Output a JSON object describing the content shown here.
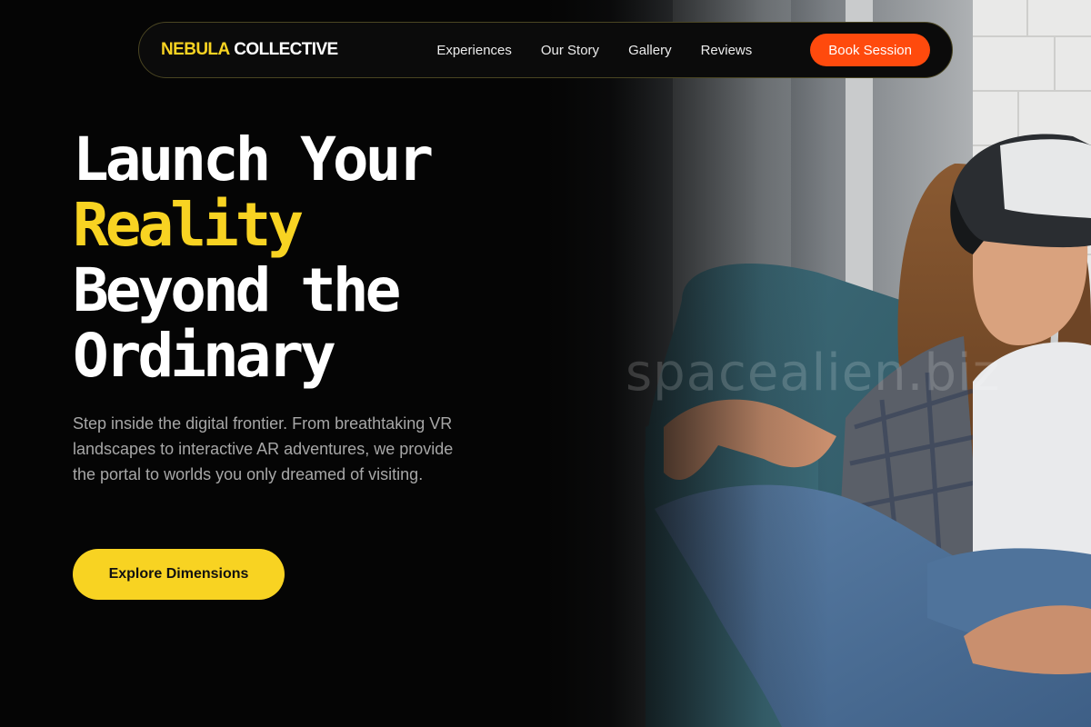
{
  "nav": {
    "brand_accent": "NEBULA",
    "brand_rest": "COLLECTIVE",
    "links": [
      "Experiences",
      "Our Story",
      "Gallery",
      "Reviews"
    ],
    "cta_label": "Book Session"
  },
  "hero": {
    "headline_line1": "Launch Your",
    "headline_accent": "Reality",
    "headline_line3": "Beyond the",
    "headline_line4": "Ordinary",
    "subcopy": "Step inside the digital frontier. From breathtaking VR landscapes to interactive AR adventures, we provide the portal to worlds you only dreamed of visiting.",
    "cta_label": "Explore Dimensions",
    "photo_watermark": "spacealien.biz"
  },
  "colors": {
    "accent_yellow": "#f8d322",
    "accent_orange": "#ff4a0d",
    "background": "#050505"
  }
}
